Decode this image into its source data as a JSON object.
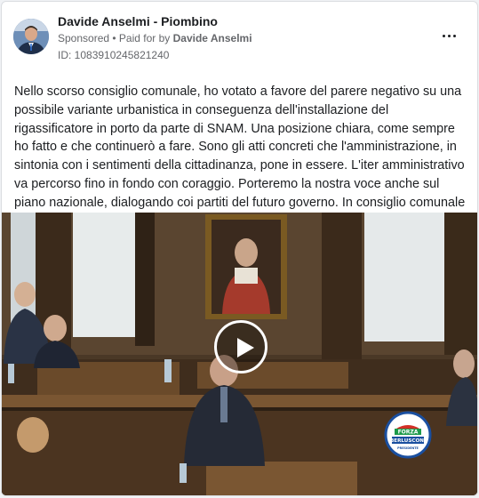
{
  "post": {
    "page_name": "Davide Anselmi - Piombino",
    "sponsored": "Sponsored",
    "paid_prefix": " • Paid for by ",
    "paid_by": "Davide Anselmi",
    "ad_id": "ID: 1083910245821240",
    "body": "Nello scorso consiglio comunale, ho votato a favore del parere negativo su una possibile variante urbanistica in conseguenza dell'installazione del rigassificatore in porto da parte di SNAM. Una posizione chiara, come sempre ho fatto e che continuerò a fare. Sono gli atti concreti che l'amministrazione, in sintonia con i sentimenti della cittadinanza, pone in essere. L'iter amministrativo va percorso fino in fondo con coraggio. Porteremo la nostra voce anche sul piano nazionale, dialogando coi partiti del futuro governo. In consiglio comunale pur votando sì all…"
  },
  "icons": {
    "more": "more-options-icon",
    "play": "play-icon",
    "party_logo": "party-logo"
  },
  "colors": {
    "name": "#1c1e21",
    "meta": "#65676b",
    "border": "#dadde1",
    "logo_blue": "#1a4fa0",
    "logo_red": "#d22f27",
    "logo_green": "#1d9a4a"
  },
  "logo": {
    "line1": "FORZA",
    "line2": "ITALIA",
    "line3": "BERLUSCONI",
    "line4": "PRESIDENTE",
    "ring": "PARTITO POPOLARE EUROPEO"
  }
}
